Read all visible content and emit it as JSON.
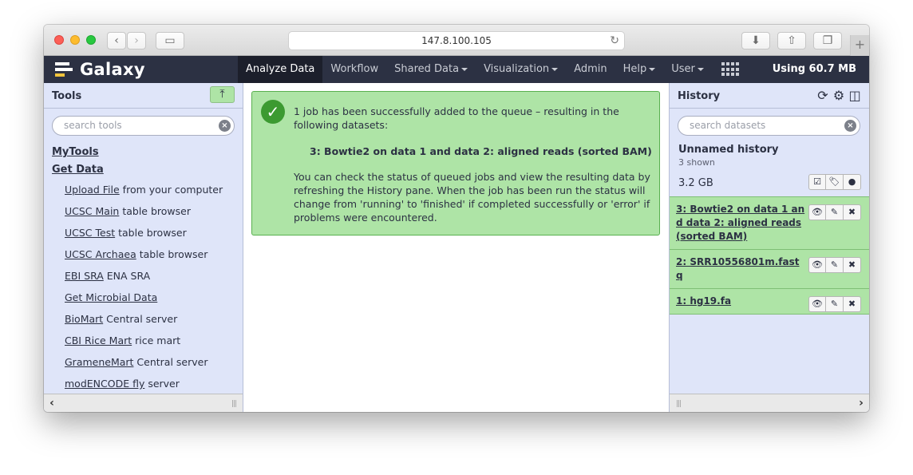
{
  "browser": {
    "url": "147.8.100.105",
    "back_icon": "chevron-left-icon",
    "forward_icon": "chevron-right-icon",
    "reload_icon": "reload-icon"
  },
  "masthead": {
    "brand": "Galaxy",
    "nav": [
      {
        "label": "Analyze Data",
        "active": true,
        "caret": false
      },
      {
        "label": "Workflow",
        "active": false,
        "caret": false
      },
      {
        "label": "Shared Data",
        "active": false,
        "caret": true
      },
      {
        "label": "Visualization",
        "active": false,
        "caret": true
      },
      {
        "label": "Admin",
        "active": false,
        "caret": false
      },
      {
        "label": "Help",
        "active": false,
        "caret": true
      },
      {
        "label": "User",
        "active": false,
        "caret": true
      }
    ],
    "usage": "Using 60.7 MB"
  },
  "tools": {
    "title": "Tools",
    "search_placeholder": "search tools",
    "sections": [
      {
        "title": "MyTools"
      },
      {
        "title": "Get Data"
      }
    ],
    "items": [
      {
        "link": "Upload File",
        "desc": " from your computer"
      },
      {
        "link": "UCSC Main",
        "desc": " table browser"
      },
      {
        "link": "UCSC Test",
        "desc": " table browser"
      },
      {
        "link": "UCSC Archaea",
        "desc": " table browser"
      },
      {
        "link": "EBI SRA",
        "desc": " ENA SRA"
      },
      {
        "link": "Get Microbial Data",
        "desc": ""
      },
      {
        "link": "BioMart",
        "desc": " Central server"
      },
      {
        "link": "CBI Rice Mart",
        "desc": " rice mart"
      },
      {
        "link": "GrameneMart",
        "desc": " Central server"
      },
      {
        "link": "modENCODE fly",
        "desc": " server"
      }
    ]
  },
  "message": {
    "intro": "1 job has been successfully added to the queue – resulting in the following datasets:",
    "dataset": "3: Bowtie2 on data 1 and data 2: aligned reads (sorted BAM)",
    "body": "You can check the status of queued jobs and view the resulting data by refreshing the History pane. When the job has been run the status will change from 'running' to 'finished' if completed successfully or 'error' if problems were encountered."
  },
  "history": {
    "title": "History",
    "search_placeholder": "search datasets",
    "name": "Unnamed history",
    "shown": "3 shown",
    "size": "3.2 GB",
    "datasets": [
      {
        "title": "3: Bowtie2 on data 1 and data 2: aligned reads (sorted BAM)"
      },
      {
        "title": "2: SRR10556801m.fastq"
      },
      {
        "title": "1: hg19.fa"
      }
    ]
  },
  "colors": {
    "masthead": "#2c3143",
    "panel": "#dfe5f9",
    "ok": "#aee4a6"
  }
}
